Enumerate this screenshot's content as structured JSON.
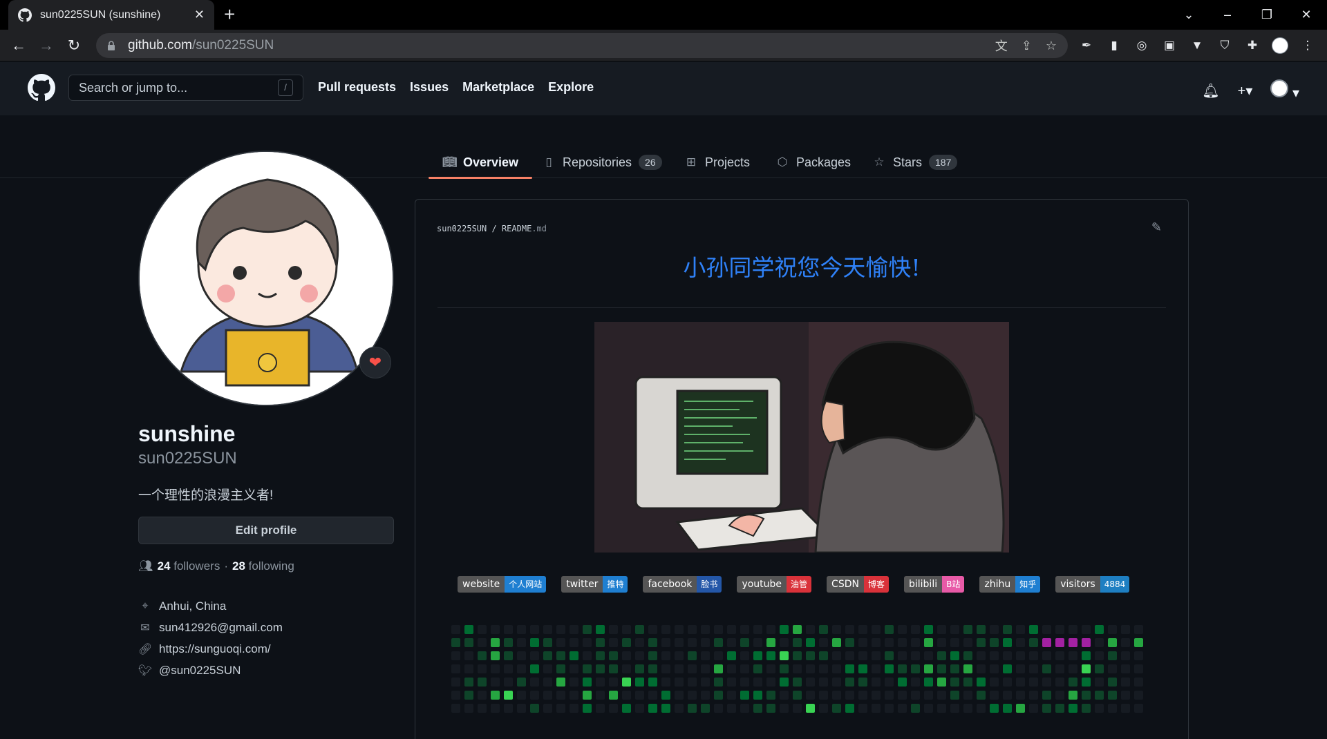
{
  "browser": {
    "tab_title": "sun0225SUN (sunshine)",
    "close_label": "✕",
    "new_tab_label": "+",
    "url_host": "github.com",
    "url_path": "/sun0225SUN"
  },
  "github": {
    "search_placeholder": "Search or jump to...",
    "search_key": "/",
    "nav": [
      "Pull requests",
      "Issues",
      "Marketplace",
      "Explore"
    ]
  },
  "tabs": [
    {
      "label": "Overview",
      "icon": "book-icon",
      "active": true
    },
    {
      "label": "Repositories",
      "icon": "repo-icon",
      "count": "26"
    },
    {
      "label": "Projects",
      "icon": "table-icon"
    },
    {
      "label": "Packages",
      "icon": "package-icon"
    },
    {
      "label": "Stars",
      "icon": "star-icon",
      "count": "187"
    }
  ],
  "profile": {
    "name": "sunshine",
    "login": "sun0225SUN",
    "bio": "一个理性的浪漫主义者!",
    "edit_label": "Edit profile",
    "followers": "24",
    "followers_label": "followers",
    "sep": "·",
    "following": "28",
    "following_label": "following",
    "location": "Anhui, China",
    "email": "sun412926@gmail.com",
    "website": "https://sunguoqi.com/",
    "twitter": "@sun0225SUN"
  },
  "readme": {
    "owner": "sun0225SUN",
    "slash": "/",
    "file": "README",
    "ext": ".md",
    "heading": "小孙同学祝您今天愉快!",
    "badges": [
      {
        "left": "website",
        "right": "个人网站",
        "color": "#1f7fd1"
      },
      {
        "left": "twitter",
        "right": "推特",
        "color": "#1f7fd1"
      },
      {
        "left": "facebook",
        "right": "脸书",
        "color": "#2457a8"
      },
      {
        "left": "youtube",
        "right": "油管",
        "color": "#d9323a"
      },
      {
        "left": "CSDN",
        "right": "博客",
        "color": "#d9323a"
      },
      {
        "left": "bilibili",
        "right": "B站",
        "color": "#e85aa7"
      },
      {
        "left": "zhihu",
        "right": "知乎",
        "color": "#1f7fd1"
      },
      {
        "left": "visitors",
        "right": "4884",
        "color": "#1e7fc2"
      }
    ]
  },
  "colors": {
    "accent": "#f78166",
    "link": "#2f81f7",
    "contrib_empty": "#161b22",
    "contrib_l1": "#0e4429",
    "contrib_l2": "#006d32",
    "contrib_l3": "#26a641",
    "contrib_l4": "#39d353",
    "contrib_purple": "#a221a2"
  }
}
